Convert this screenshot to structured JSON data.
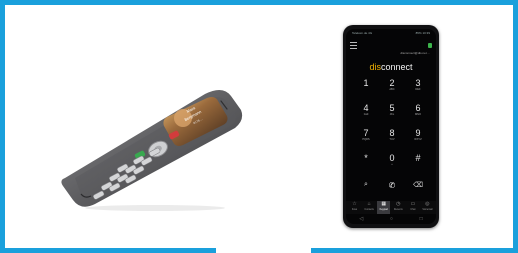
{
  "left_product": {
    "caller_first_name": "Mara",
    "caller_last_name": "Bergmann",
    "caller_number": "0176 ..."
  },
  "right_product": {
    "status_left": "Telekom.de  4G",
    "status_right": "85%  10:39",
    "account_line": "disconnect@dis.net ...",
    "logo_prefix": "dis",
    "logo_suffix": "connect",
    "keypad": [
      {
        "digit": "1",
        "letters": ""
      },
      {
        "digit": "2",
        "letters": "ABC"
      },
      {
        "digit": "3",
        "letters": "DEF"
      },
      {
        "digit": "4",
        "letters": "GHI"
      },
      {
        "digit": "5",
        "letters": "JKL"
      },
      {
        "digit": "6",
        "letters": "MNO"
      },
      {
        "digit": "7",
        "letters": "PQRS"
      },
      {
        "digit": "8",
        "letters": "TUV"
      },
      {
        "digit": "9",
        "letters": "WXYZ"
      },
      {
        "digit": "*",
        "letters": ""
      },
      {
        "digit": "0",
        "letters": "+"
      },
      {
        "digit": "#",
        "letters": ""
      }
    ],
    "actions": {
      "search": "⌕",
      "call": "✆",
      "delete": "⌫"
    },
    "tabs": [
      {
        "icon": "☆",
        "label": "Favs"
      },
      {
        "icon": "⌂",
        "label": "Contacts"
      },
      {
        "icon": "▦",
        "label": "Keypad"
      },
      {
        "icon": "◷",
        "label": "Recents"
      },
      {
        "icon": "▭",
        "label": "Chat"
      },
      {
        "icon": "◎",
        "label": "Voicemail"
      }
    ],
    "nav": {
      "back": "◁",
      "home": "○",
      "recents": "□"
    }
  },
  "colors": {
    "border": "#1aa0dc",
    "logo_accent": "#f2b200",
    "online": "#3cb44b"
  }
}
